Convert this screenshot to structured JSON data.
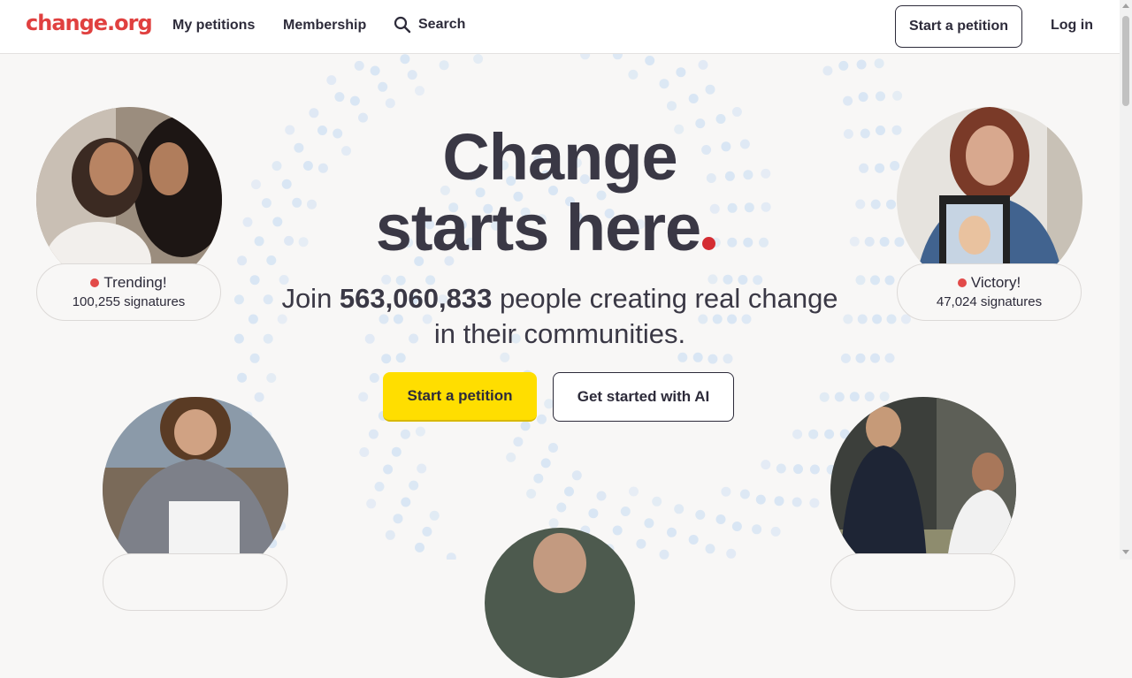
{
  "header": {
    "logo": "change.org",
    "nav": [
      "My petitions",
      "Membership"
    ],
    "search_label": "Search",
    "start_petition": "Start a petition",
    "login": "Log in"
  },
  "hero": {
    "line1": "Change",
    "line2": "starts here",
    "sub_pre": "Join ",
    "sub_count": "563,060,833",
    "sub_post": " people creating real change",
    "sub_line2": "in their communities.",
    "cta_primary": "Start a petition",
    "cta_secondary": "Get started with AI"
  },
  "cards": [
    {
      "status": "Trending!",
      "signatures": "100,255 signatures"
    },
    {
      "status": "Victory!",
      "signatures": "47,024 signatures"
    }
  ],
  "colors": {
    "brand": "#e0403f",
    "accent_yellow": "#ffde00",
    "text": "#2d2b3a",
    "dot_red": "#d42d33"
  }
}
